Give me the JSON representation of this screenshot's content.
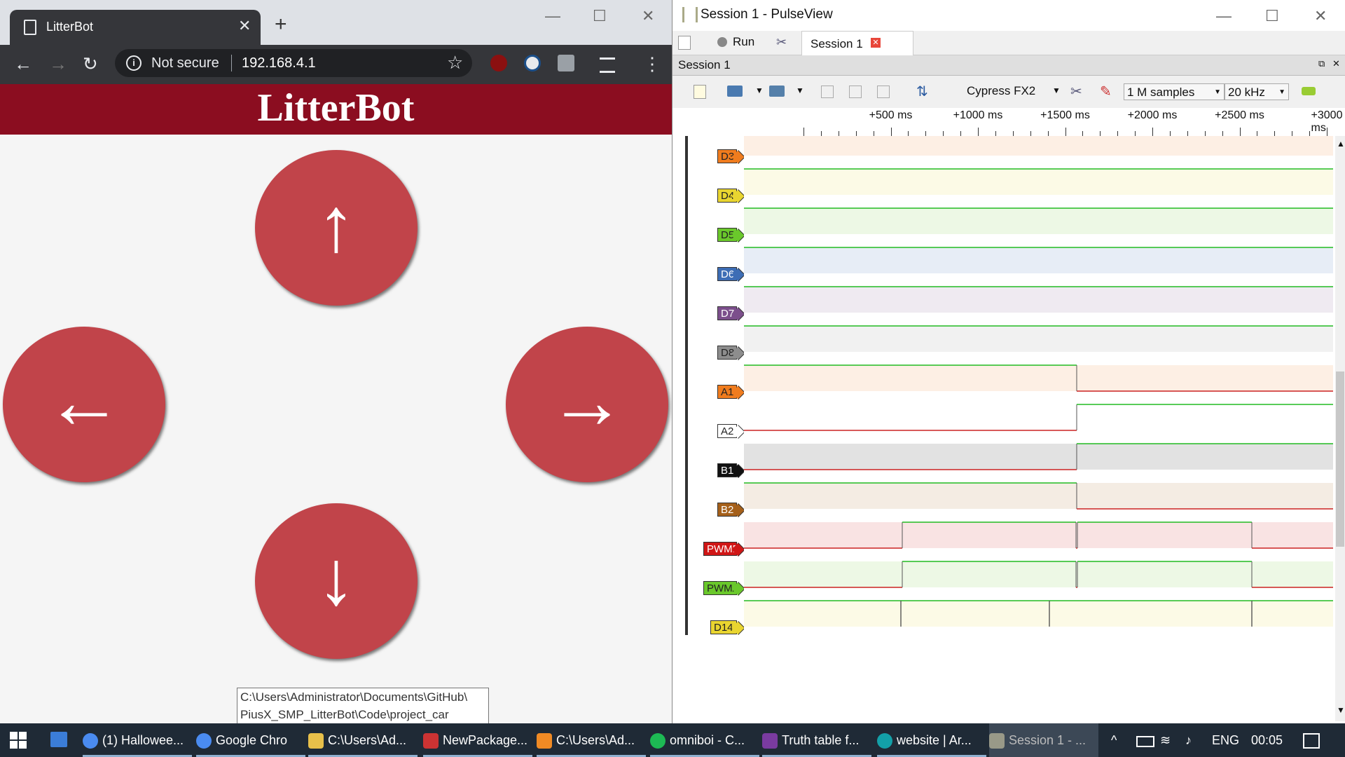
{
  "chrome": {
    "tab_title": "LitterBot",
    "close_glyph": "✕",
    "new_tab_glyph": "+",
    "window_controls": {
      "minimize": "—",
      "maximize": "☐",
      "close": "✕"
    },
    "nav": {
      "back": "←",
      "forward": "→",
      "reload": "↻"
    },
    "omnibox": {
      "info_glyph": "i",
      "security": "Not secure",
      "url": "192.168.4.1",
      "star": "☆"
    },
    "extensions": [
      "ublock-icon",
      "extension-icon",
      "s-extension-icon",
      "incognito-icon"
    ],
    "menu_glyph": "⋮"
  },
  "page": {
    "heading": "LitterBot",
    "buttons": {
      "up": "↑",
      "left": "←",
      "right": "→",
      "down": "↓"
    },
    "tooltip_line1": "C:\\Users\\Administrator\\Documents\\GitHub\\",
    "tooltip_line2": "PiusX_SMP_LitterBot\\Code\\project_car"
  },
  "pulseview": {
    "window_title": "Session 1 - PulseView",
    "window_controls": {
      "minimize": "—",
      "maximize": "☐",
      "close": "✕"
    },
    "run_label": "Run",
    "session_tab": "Session 1",
    "session_bar": "Session 1",
    "device": "Cypress FX2",
    "samples": "1 M samples",
    "rate": "20 kHz",
    "ruler_labels": [
      "+500 ms",
      "+1000 ms",
      "+1500 ms",
      "+2000 ms",
      "+2500 ms",
      "+3000 ms"
    ],
    "channels": [
      {
        "name": "D3",
        "color": "#f07c1e",
        "text": "#222"
      },
      {
        "name": "D4",
        "color": "#e9d530",
        "text": "#222"
      },
      {
        "name": "D5",
        "color": "#6ac82b",
        "text": "#222"
      },
      {
        "name": "D6",
        "color": "#3d6db5",
        "text": "#fff"
      },
      {
        "name": "D7",
        "color": "#7c4f8c",
        "text": "#fff"
      },
      {
        "name": "D8",
        "color": "#8d8d8d",
        "text": "#222"
      },
      {
        "name": "A1",
        "color": "#f07c1e",
        "text": "#222"
      },
      {
        "name": "A2",
        "color": "#ffffff",
        "text": "#222"
      },
      {
        "name": "B1",
        "color": "#111111",
        "text": "#fff"
      },
      {
        "name": "B2",
        "color": "#a5601a",
        "text": "#fff"
      },
      {
        "name": "PWMB",
        "color": "#d01616",
        "text": "#fff"
      },
      {
        "name": "PWMA",
        "color": "#6ac82b",
        "text": "#222"
      },
      {
        "name": "D14",
        "color": "#e9d530",
        "text": "#222"
      }
    ]
  },
  "taskbar": {
    "items": [
      {
        "label": "(1) Hallowee...",
        "icon": "chrome-icon"
      },
      {
        "label": "Google Chro",
        "icon": "chrome-icon"
      },
      {
        "label": "C:\\Users\\Ad...",
        "icon": "folder-icon"
      },
      {
        "label": "NewPackage...",
        "icon": "app-icon"
      },
      {
        "label": "C:\\Users\\Ad...",
        "icon": "sublime-icon"
      },
      {
        "label": "omniboi - C...",
        "icon": "spotify-icon"
      },
      {
        "label": "Truth table f...",
        "icon": "onenote-icon"
      },
      {
        "label": "website | Ar...",
        "icon": "arduino-icon"
      },
      {
        "label": "Session 1 - ...",
        "icon": "pulseview-icon"
      }
    ],
    "language": "ENG",
    "time": "00:05"
  }
}
